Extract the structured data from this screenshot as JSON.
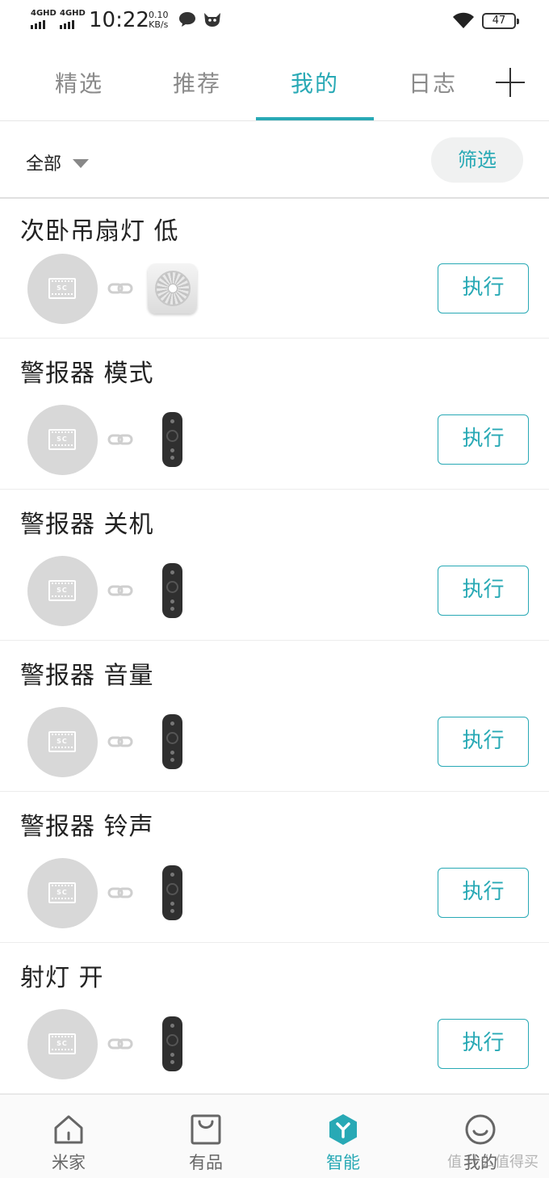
{
  "status_bar": {
    "sim1": "4GHD",
    "sim2": "4GHD",
    "time": "10:22",
    "net_speed_value": "0.10",
    "net_speed_unit": "KB/s",
    "battery": "47"
  },
  "tabs": [
    {
      "label": "精选",
      "active": false
    },
    {
      "label": "推荐",
      "active": false
    },
    {
      "label": "我的",
      "active": true
    },
    {
      "label": "日志",
      "active": false
    }
  ],
  "filter": {
    "all_label": "全部",
    "filter_button": "筛选"
  },
  "scenes": [
    {
      "title": "次卧吊扇灯 低",
      "device": "fan-icon",
      "action": "执行"
    },
    {
      "title": "警报器 模式",
      "device": "remote-icon",
      "action": "执行"
    },
    {
      "title": "警报器 关机",
      "device": "remote-icon",
      "action": "执行"
    },
    {
      "title": "警报器 音量",
      "device": "remote-icon",
      "action": "执行"
    },
    {
      "title": "警报器 铃声",
      "device": "remote-icon",
      "action": "执行"
    },
    {
      "title": "射灯 开",
      "device": "remote-icon",
      "action": "执行"
    }
  ],
  "scene_icon_text": "SC",
  "bottom_nav": [
    {
      "label": "米家",
      "icon": "home-icon",
      "active": false
    },
    {
      "label": "有品",
      "icon": "bag-icon",
      "active": false
    },
    {
      "label": "智能",
      "icon": "smart-icon",
      "active": true
    },
    {
      "label": "我的",
      "icon": "profile-icon",
      "active": false
    }
  ],
  "watermark": "值 什么值得买",
  "colors": {
    "accent": "#28a9b5",
    "text": "#222222",
    "muted": "#8a8a8a"
  }
}
